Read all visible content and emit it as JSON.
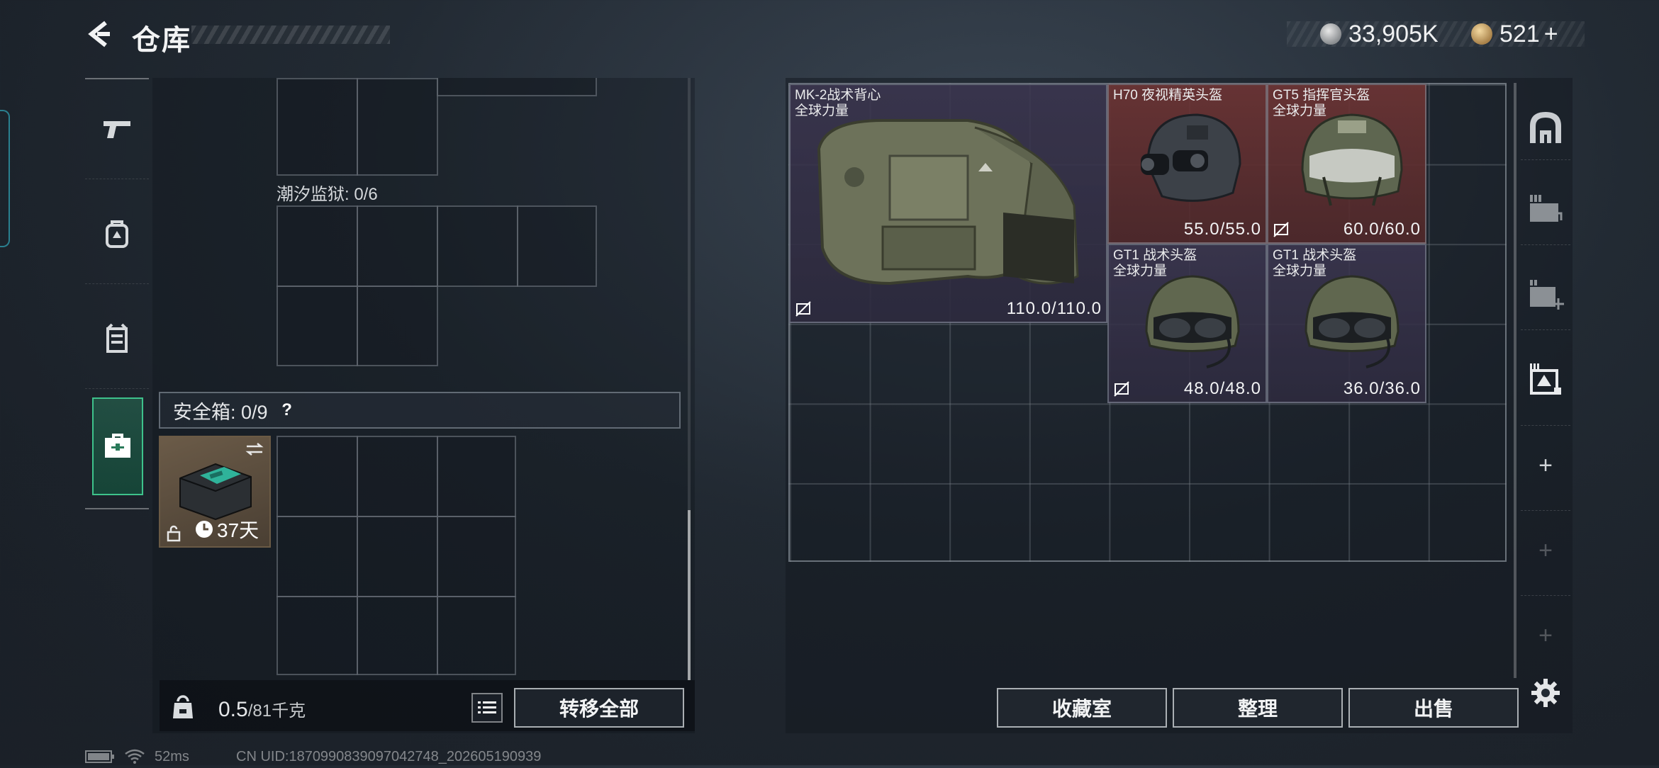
{
  "header": {
    "title": "仓库",
    "currency_main": "33,905K",
    "currency_secondary": "521",
    "currency_plus": "+"
  },
  "left_nav": {
    "items": [
      "pistol-icon",
      "backpack-icon",
      "vest-icon",
      "briefcase-icon"
    ],
    "active": "briefcase-icon"
  },
  "left_panel": {
    "container_label": "潮汐监狱: 0/6",
    "safe_box_label": "安全箱: 0/9",
    "safe_box_help": "?",
    "safe_item_timer": "37天",
    "weight_value": "0.5",
    "weight_max": "/81千克",
    "transfer_all": "转移全部"
  },
  "stash": {
    "items": [
      {
        "name_line1": "MK-2战术背心",
        "name_line2": "全球力量",
        "durability": "110.0/110.0",
        "rarity": "purple"
      },
      {
        "name_line1": "H70 夜视精英头盔",
        "name_line2": "",
        "durability": "55.0/55.0",
        "rarity": "red"
      },
      {
        "name_line1": "GT5 指挥官头盔",
        "name_line2": "全球力量",
        "durability": "60.0/60.0",
        "rarity": "red"
      },
      {
        "name_line1": "GT1 战术头盔",
        "name_line2": "全球力量",
        "durability": "48.0/48.0",
        "rarity": "purple"
      },
      {
        "name_line1": "GT1 战术头盔",
        "name_line2": "全球力量",
        "durability": "36.0/36.0",
        "rarity": "purple"
      }
    ]
  },
  "bottom_buttons": {
    "collection": "收藏室",
    "sort": "整理",
    "sell": "出售"
  },
  "status_bar": {
    "ping": "52ms",
    "uid": "CN UID:1870990839097042748_202605190939"
  },
  "colors": {
    "accent_green": "#3ec28b",
    "rarity_red": "#6e3434",
    "rarity_purple": "#3c3650"
  }
}
